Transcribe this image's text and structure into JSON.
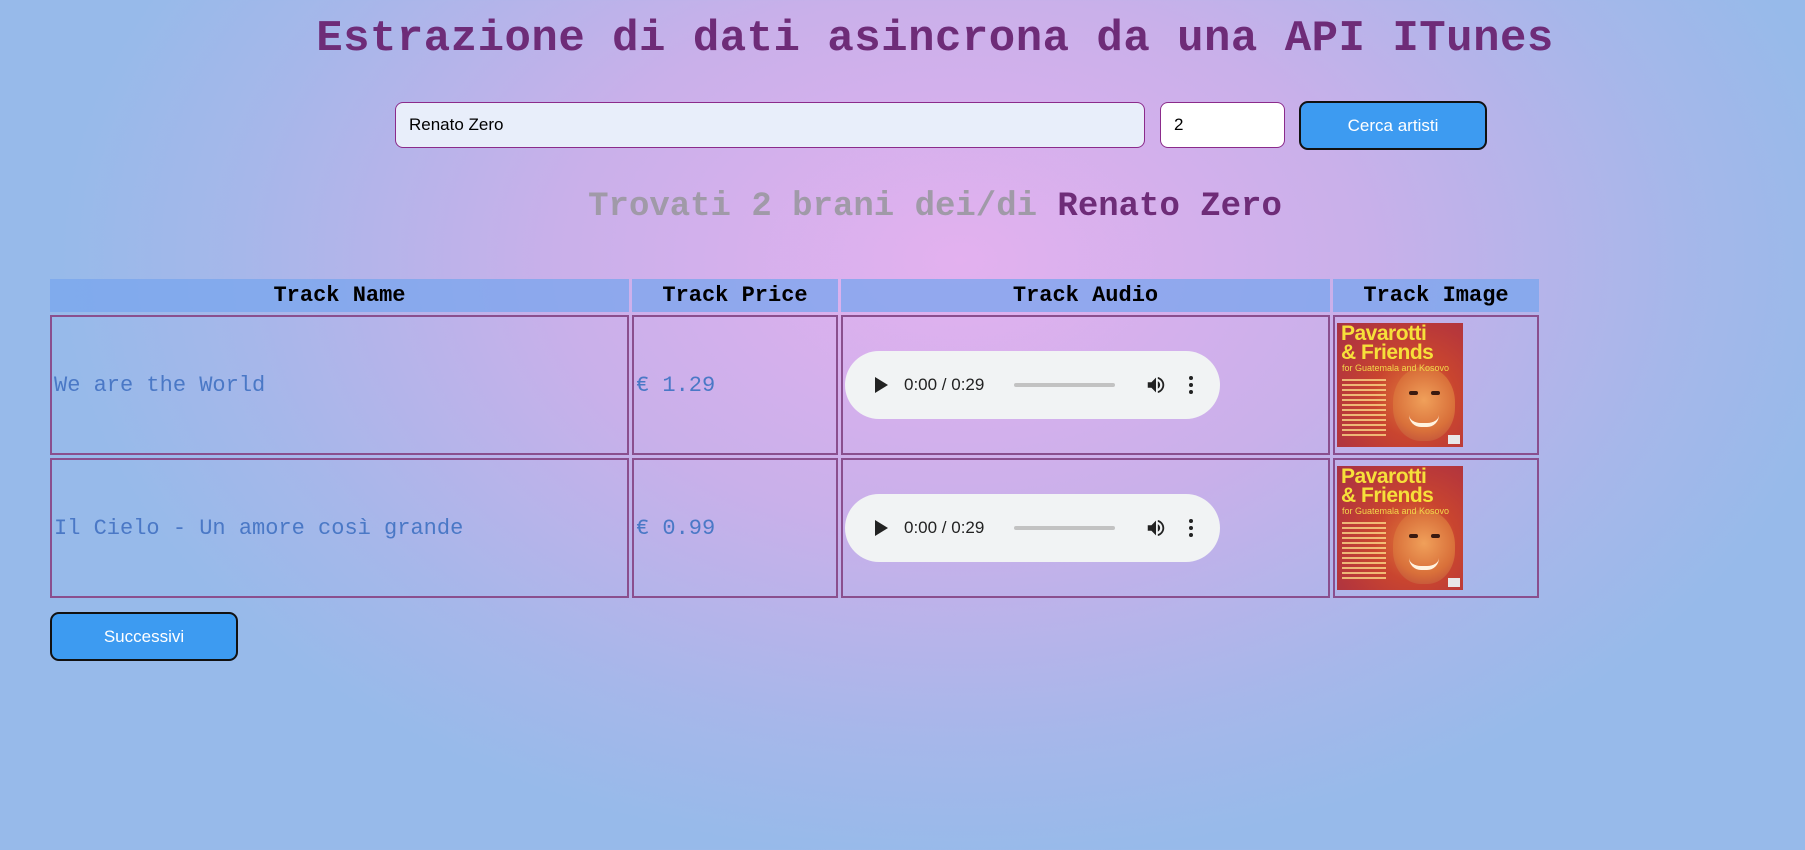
{
  "header": {
    "title": "Estrazione di dati asincrona da una API ITunes"
  },
  "search": {
    "artist_value": "Renato Zero",
    "count_value": "2",
    "button_label": "Cerca artisti"
  },
  "result": {
    "prefix": "Trovati 2 brani dei/di ",
    "artist": "Renato Zero"
  },
  "table": {
    "headers": [
      "Track Name",
      "Track Price",
      "Track Audio",
      "Track Image"
    ],
    "rows": [
      {
        "name": "We are the World",
        "price": "€ 1.29",
        "audio_time": "0:00 / 0:29",
        "image": {
          "title_line1": "Pavarotti",
          "title_line2": "& Friends",
          "subtitle": "for Guatemala and Kosovo"
        }
      },
      {
        "name": "Il Cielo - Un amore così grande",
        "price": "€ 0.99",
        "audio_time": "0:00 / 0:29",
        "image": {
          "title_line1": "Pavarotti",
          "title_line2": "& Friends",
          "subtitle": "for Guatemala and Kosovo"
        }
      }
    ]
  },
  "pagination": {
    "next_label": "Successivi"
  },
  "icons": {
    "play": "play-icon",
    "volume": "volume-icon",
    "more": "more-vert-icon"
  },
  "colors": {
    "title": "#6e2c78",
    "button": "#3d9bf1",
    "track_text": "#4a78c6",
    "result_prefix": "#a09aa8"
  }
}
